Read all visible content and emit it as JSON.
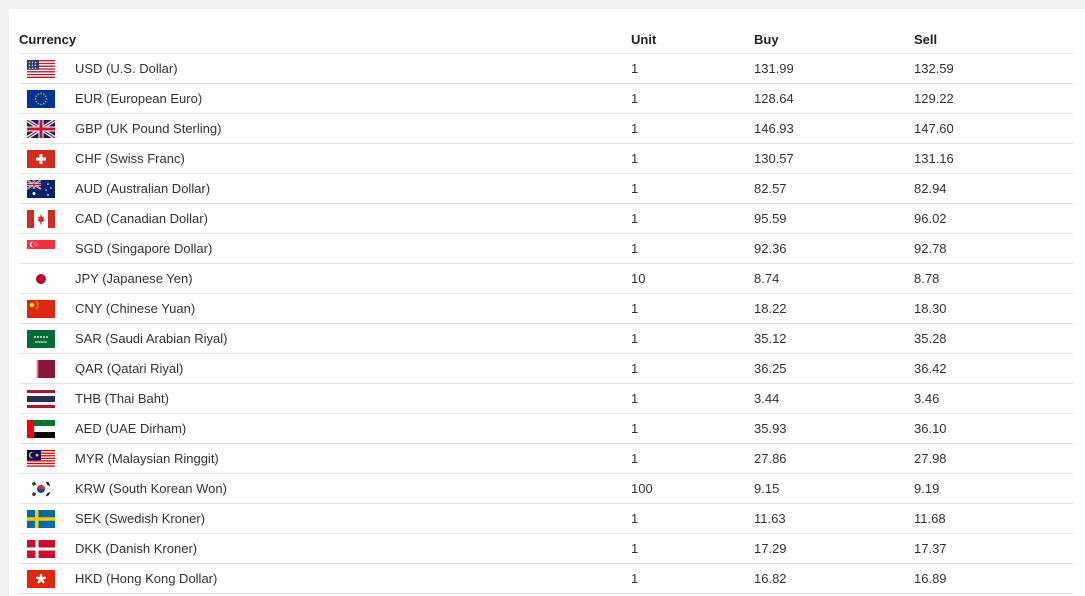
{
  "table": {
    "headers": {
      "currency": "Currency",
      "unit": "Unit",
      "buy": "Buy",
      "sell": "Sell"
    },
    "rows": [
      {
        "flag": "us-flag-icon",
        "currency": "USD (U.S. Dollar)",
        "unit": "1",
        "buy": "131.99",
        "sell": "132.59"
      },
      {
        "flag": "eu-flag-icon",
        "currency": "EUR (European Euro)",
        "unit": "1",
        "buy": "128.64",
        "sell": "129.22"
      },
      {
        "flag": "gb-flag-icon",
        "currency": "GBP (UK Pound Sterling)",
        "unit": "1",
        "buy": "146.93",
        "sell": "147.60"
      },
      {
        "flag": "ch-flag-icon",
        "currency": "CHF (Swiss Franc)",
        "unit": "1",
        "buy": "130.57",
        "sell": "131.16"
      },
      {
        "flag": "au-flag-icon",
        "currency": "AUD (Australian Dollar)",
        "unit": "1",
        "buy": "82.57",
        "sell": "82.94"
      },
      {
        "flag": "ca-flag-icon",
        "currency": "CAD (Canadian Dollar)",
        "unit": "1",
        "buy": "95.59",
        "sell": "96.02"
      },
      {
        "flag": "sg-flag-icon",
        "currency": "SGD (Singapore Dollar)",
        "unit": "1",
        "buy": "92.36",
        "sell": "92.78"
      },
      {
        "flag": "jp-flag-icon",
        "currency": "JPY (Japanese Yen)",
        "unit": "10",
        "buy": "8.74",
        "sell": "8.78"
      },
      {
        "flag": "cn-flag-icon",
        "currency": "CNY (Chinese Yuan)",
        "unit": "1",
        "buy": "18.22",
        "sell": "18.30"
      },
      {
        "flag": "sa-flag-icon",
        "currency": "SAR (Saudi Arabian Riyal)",
        "unit": "1",
        "buy": "35.12",
        "sell": "35.28"
      },
      {
        "flag": "qa-flag-icon",
        "currency": "QAR (Qatari Riyal)",
        "unit": "1",
        "buy": "36.25",
        "sell": "36.42"
      },
      {
        "flag": "th-flag-icon",
        "currency": "THB (Thai Baht)",
        "unit": "1",
        "buy": "3.44",
        "sell": "3.46"
      },
      {
        "flag": "ae-flag-icon",
        "currency": "AED (UAE Dirham)",
        "unit": "1",
        "buy": "35.93",
        "sell": "36.10"
      },
      {
        "flag": "my-flag-icon",
        "currency": "MYR (Malaysian Ringgit)",
        "unit": "1",
        "buy": "27.86",
        "sell": "27.98"
      },
      {
        "flag": "kr-flag-icon",
        "currency": "KRW (South Korean Won)",
        "unit": "100",
        "buy": "9.15",
        "sell": "9.19"
      },
      {
        "flag": "se-flag-icon",
        "currency": "SEK (Swedish Kroner)",
        "unit": "1",
        "buy": "11.63",
        "sell": "11.68"
      },
      {
        "flag": "dk-flag-icon",
        "currency": "DKK (Danish Kroner)",
        "unit": "1",
        "buy": "17.29",
        "sell": "17.37"
      },
      {
        "flag": "hk-flag-icon",
        "currency": "HKD (Hong Kong Dollar)",
        "unit": "1",
        "buy": "16.82",
        "sell": "16.89"
      }
    ]
  }
}
